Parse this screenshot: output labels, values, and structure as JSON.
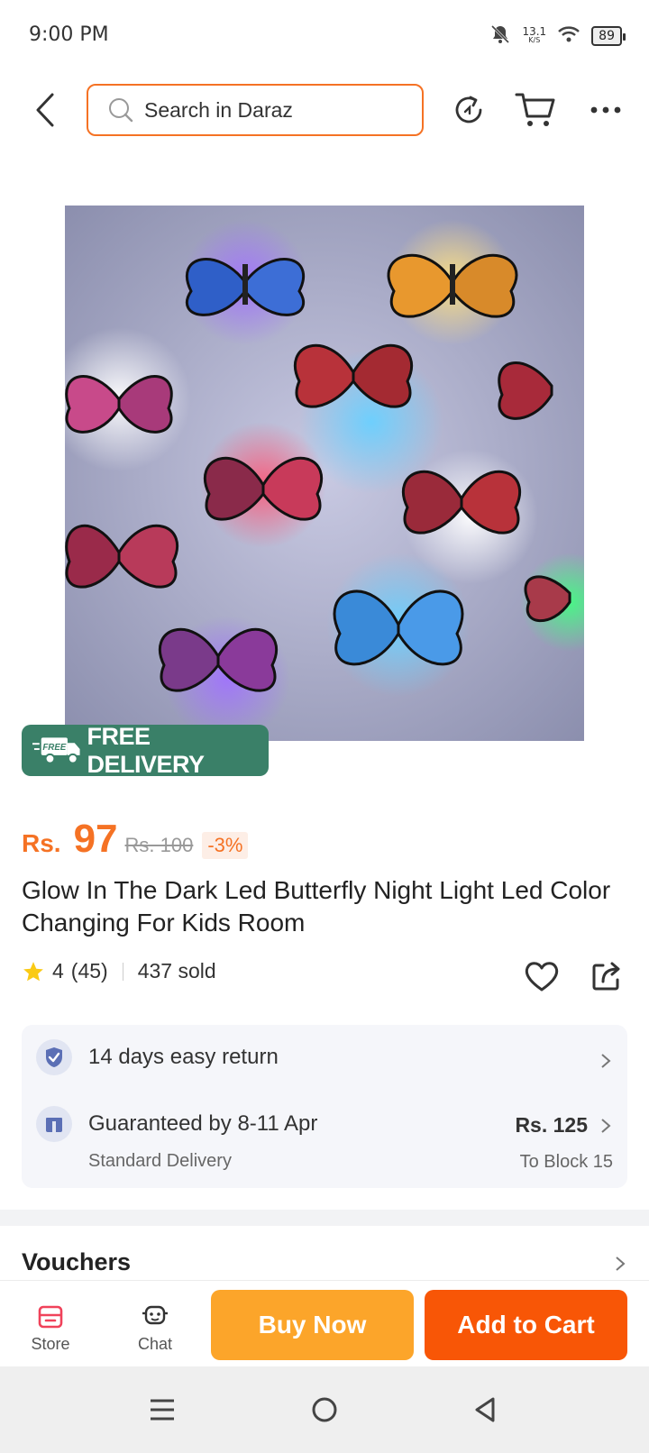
{
  "status_bar": {
    "time": "9:00 PM",
    "speed_value": "13.1",
    "speed_unit": "K/S",
    "battery": "89",
    "icons": [
      "bell-off-icon",
      "wifi-icon",
      "battery-icon"
    ]
  },
  "header": {
    "search_placeholder": "Search in Daraz",
    "icons": [
      "back-icon",
      "search-icon",
      "share-rotate-icon",
      "cart-icon",
      "more-icon"
    ]
  },
  "product": {
    "badge": "FREE DELIVERY",
    "badge_icon_text": "FREE",
    "currency": "Rs.",
    "price": "97",
    "original_price": "Rs. 100",
    "discount": "-3%",
    "title": "Glow In The Dark Led Butterfly Night Light Led Color Changing For Kids Room",
    "rating": "4",
    "reviews": "(45)",
    "sold": "437 sold"
  },
  "delivery": {
    "return_policy": "14 days easy return",
    "guarantee": "Guaranteed by 8-11 Apr",
    "method": "Standard Delivery",
    "fee": "Rs. 125",
    "destination": "To Block 15"
  },
  "vouchers": {
    "label": "Vouchers"
  },
  "action_bar": {
    "store_label": "Store",
    "chat_label": "Chat",
    "buy_now": "Buy Now",
    "add_to_cart": "Add to Cart"
  },
  "colors": {
    "accent": "#f57224",
    "buy_now": "#fca52a",
    "add_to_cart": "#f85606",
    "free_badge": "#3a8068"
  }
}
